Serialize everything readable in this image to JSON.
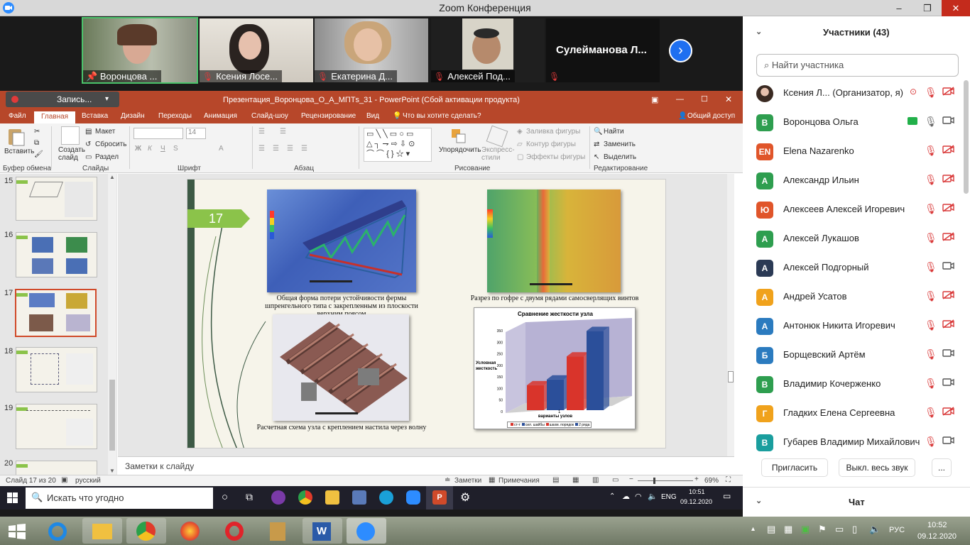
{
  "zoom": {
    "title": "Zoom Конференция",
    "window_buttons": [
      "–",
      "❐",
      "✕"
    ]
  },
  "gallery": {
    "tiles": [
      {
        "name": "Воронцова ...",
        "pinned": true
      },
      {
        "name": "Ксения Лосе...",
        "muted": true
      },
      {
        "name": "Екатерина Д...",
        "muted": true
      },
      {
        "name": "Алексей Под...",
        "muted": true
      },
      {
        "name": "Сулейманова  Л...",
        "muted": true
      }
    ],
    "next_label": "›"
  },
  "ppt": {
    "recording_label": "Запись...",
    "window_title": "Презентация_Воронцова_О_А_МПТs_31 - PowerPoint (Сбой активации продукта)",
    "tabs": [
      "Файл",
      "Главная",
      "Вставка",
      "Дизайн",
      "Переходы",
      "Анимация",
      "Слайд-шоу",
      "Рецензирование",
      "Вид"
    ],
    "tell_me": "Что вы хотите сделать?",
    "share": "Общий доступ",
    "ribbon": {
      "paste": "Вставить",
      "new_slide": "Создать слайд",
      "layout": "Макет",
      "reset": "Сбросить",
      "section": "Раздел",
      "font_size": "14",
      "arrange": "Упорядочить",
      "quick_styles": "Экспресс-стили",
      "shape_fill": "Заливка фигуры",
      "shape_outline": "Контур фигуры",
      "shape_effects": "Эффекты фигуры",
      "find": "Найти",
      "replace": "Заменить",
      "select": "Выделить",
      "groups": [
        "Буфер обмена",
        "Слайды",
        "Шрифт",
        "Абзац",
        "Рисование",
        "Редактирование"
      ]
    },
    "thumbnails": [
      {
        "num": "15"
      },
      {
        "num": "16"
      },
      {
        "num": "17",
        "selected": true
      },
      {
        "num": "18"
      },
      {
        "num": "19"
      },
      {
        "num": "20"
      }
    ],
    "slide": {
      "number": "17",
      "caption_1": "Общая форма потери устойчивости фермы шпренгельного типа с закрепленным из плоскости верхним поясом",
      "caption_2": "Разрез по гофре с двумя рядами самосверлящих винтов",
      "caption_3": "Расчетная схема узла с креплением настила через волну"
    },
    "notes_placeholder": "Заметки к слайду",
    "status": {
      "slide_of": "Слайд 17 из 20",
      "language": "русский",
      "notes": "Заметки",
      "comments": "Примечания",
      "zoom": "69%"
    }
  },
  "chart_data": {
    "type": "bar",
    "title": "Сравнение жесткости узла",
    "ylabel": "Условная жесткость",
    "xlabel": "варианты узлов",
    "categories": [
      "1"
    ],
    "ylim": [
      0,
      350
    ],
    "yticks": [
      0,
      50,
      100,
      150,
      200,
      250,
      300,
      350
    ],
    "series": [
      {
        "name": "ст-т",
        "values": [
          120
        ],
        "color": "#d9342b"
      },
      {
        "name": "сил. шайбы",
        "values": [
          145
        ],
        "color": "#2b4f9a"
      },
      {
        "name": "шахм. порядок",
        "values": [
          245
        ],
        "color": "#d9342b"
      },
      {
        "name": "2 ряда",
        "values": [
          355
        ],
        "color": "#2b4f9a"
      }
    ],
    "legend_position": "bottom",
    "three_d": true
  },
  "participants": {
    "header": "Участники (43)",
    "search_placeholder": "Найти участника",
    "list": [
      {
        "name": "Ксения Л...  (Организатор, я)",
        "initial": "",
        "color": "#7a5a4a",
        "photo": true,
        "video": false
      },
      {
        "name": "Воронцова Ольга",
        "initial": "В",
        "color": "#2e9e4f",
        "mic_on": true,
        "video": true,
        "sharing": true
      },
      {
        "name": "Elena Nazarenko",
        "initial": "EN",
        "color": "#e0552a",
        "video": false
      },
      {
        "name": "Александр Ильин",
        "initial": "А",
        "color": "#2e9e4f",
        "video": false
      },
      {
        "name": "Алексеев Алексей Игоревич",
        "initial": "Ю",
        "color": "#e0552a",
        "video": false
      },
      {
        "name": "Алексей Лукашов",
        "initial": "А",
        "color": "#2e9e4f",
        "video": false
      },
      {
        "name": "Алексей Подгорный",
        "initial": "А",
        "color": "#2b3a55",
        "video": true
      },
      {
        "name": "Андрей Усатов",
        "initial": "А",
        "color": "#f0a21c",
        "video": false
      },
      {
        "name": "Антонюк Никита Игоревич",
        "initial": "А",
        "color": "#2b7bbf",
        "video": false
      },
      {
        "name": "Борщевский Артём",
        "initial": "Б",
        "color": "#2b7bbf",
        "video": true
      },
      {
        "name": "Владимир Кочерженко",
        "initial": "В",
        "color": "#2e9e4f",
        "video": true
      },
      {
        "name": "Гладких Елена Сергеевна",
        "initial": "Г",
        "color": "#f0a21c",
        "video": false
      },
      {
        "name": "Губарев Владимир Михайлович",
        "initial": "В",
        "color": "#1a9e9e",
        "video": true
      }
    ],
    "invite": "Пригласить",
    "mute_all": "Выкл. весь звук",
    "more": "...",
    "chat": "Чат"
  },
  "remote_taskbar": {
    "search": "Искать что угодно",
    "lang": "ENG",
    "time": "10:51",
    "date": "09.12.2020"
  },
  "taskbar": {
    "lang": "РУС",
    "time": "10:52",
    "date": "09.12.2020"
  }
}
